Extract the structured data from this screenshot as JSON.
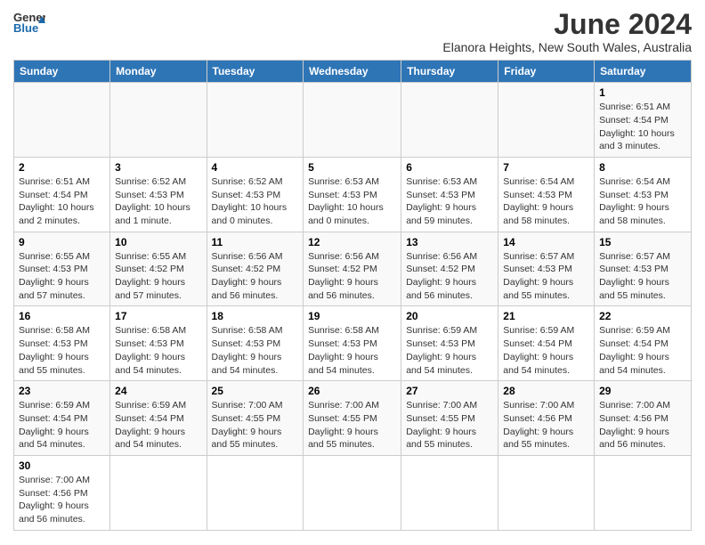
{
  "header": {
    "logo_general": "General",
    "logo_blue": "Blue",
    "title": "June 2024",
    "subtitle": "Elanora Heights, New South Wales, Australia"
  },
  "days_of_week": [
    "Sunday",
    "Monday",
    "Tuesday",
    "Wednesday",
    "Thursday",
    "Friday",
    "Saturday"
  ],
  "weeks": [
    [
      {
        "day": "",
        "info": ""
      },
      {
        "day": "",
        "info": ""
      },
      {
        "day": "",
        "info": ""
      },
      {
        "day": "",
        "info": ""
      },
      {
        "day": "",
        "info": ""
      },
      {
        "day": "",
        "info": ""
      },
      {
        "day": "1",
        "info": "Sunrise: 6:51 AM\nSunset: 4:54 PM\nDaylight: 10 hours and 3 minutes."
      }
    ],
    [
      {
        "day": "2",
        "info": "Sunrise: 6:51 AM\nSunset: 4:54 PM\nDaylight: 10 hours and 2 minutes."
      },
      {
        "day": "3",
        "info": "Sunrise: 6:52 AM\nSunset: 4:53 PM\nDaylight: 10 hours and 1 minute."
      },
      {
        "day": "4",
        "info": "Sunrise: 6:52 AM\nSunset: 4:53 PM\nDaylight: 10 hours and 0 minutes."
      },
      {
        "day": "5",
        "info": "Sunrise: 6:53 AM\nSunset: 4:53 PM\nDaylight: 10 hours and 0 minutes."
      },
      {
        "day": "6",
        "info": "Sunrise: 6:53 AM\nSunset: 4:53 PM\nDaylight: 9 hours and 59 minutes."
      },
      {
        "day": "7",
        "info": "Sunrise: 6:54 AM\nSunset: 4:53 PM\nDaylight: 9 hours and 58 minutes."
      },
      {
        "day": "8",
        "info": "Sunrise: 6:54 AM\nSunset: 4:53 PM\nDaylight: 9 hours and 58 minutes."
      }
    ],
    [
      {
        "day": "9",
        "info": "Sunrise: 6:55 AM\nSunset: 4:53 PM\nDaylight: 9 hours and 57 minutes."
      },
      {
        "day": "10",
        "info": "Sunrise: 6:55 AM\nSunset: 4:52 PM\nDaylight: 9 hours and 57 minutes."
      },
      {
        "day": "11",
        "info": "Sunrise: 6:56 AM\nSunset: 4:52 PM\nDaylight: 9 hours and 56 minutes."
      },
      {
        "day": "12",
        "info": "Sunrise: 6:56 AM\nSunset: 4:52 PM\nDaylight: 9 hours and 56 minutes."
      },
      {
        "day": "13",
        "info": "Sunrise: 6:56 AM\nSunset: 4:52 PM\nDaylight: 9 hours and 56 minutes."
      },
      {
        "day": "14",
        "info": "Sunrise: 6:57 AM\nSunset: 4:53 PM\nDaylight: 9 hours and 55 minutes."
      },
      {
        "day": "15",
        "info": "Sunrise: 6:57 AM\nSunset: 4:53 PM\nDaylight: 9 hours and 55 minutes."
      }
    ],
    [
      {
        "day": "16",
        "info": "Sunrise: 6:58 AM\nSunset: 4:53 PM\nDaylight: 9 hours and 55 minutes."
      },
      {
        "day": "17",
        "info": "Sunrise: 6:58 AM\nSunset: 4:53 PM\nDaylight: 9 hours and 54 minutes."
      },
      {
        "day": "18",
        "info": "Sunrise: 6:58 AM\nSunset: 4:53 PM\nDaylight: 9 hours and 54 minutes."
      },
      {
        "day": "19",
        "info": "Sunrise: 6:58 AM\nSunset: 4:53 PM\nDaylight: 9 hours and 54 minutes."
      },
      {
        "day": "20",
        "info": "Sunrise: 6:59 AM\nSunset: 4:53 PM\nDaylight: 9 hours and 54 minutes."
      },
      {
        "day": "21",
        "info": "Sunrise: 6:59 AM\nSunset: 4:54 PM\nDaylight: 9 hours and 54 minutes."
      },
      {
        "day": "22",
        "info": "Sunrise: 6:59 AM\nSunset: 4:54 PM\nDaylight: 9 hours and 54 minutes."
      }
    ],
    [
      {
        "day": "23",
        "info": "Sunrise: 6:59 AM\nSunset: 4:54 PM\nDaylight: 9 hours and 54 minutes."
      },
      {
        "day": "24",
        "info": "Sunrise: 6:59 AM\nSunset: 4:54 PM\nDaylight: 9 hours and 54 minutes."
      },
      {
        "day": "25",
        "info": "Sunrise: 7:00 AM\nSunset: 4:55 PM\nDaylight: 9 hours and 55 minutes."
      },
      {
        "day": "26",
        "info": "Sunrise: 7:00 AM\nSunset: 4:55 PM\nDaylight: 9 hours and 55 minutes."
      },
      {
        "day": "27",
        "info": "Sunrise: 7:00 AM\nSunset: 4:55 PM\nDaylight: 9 hours and 55 minutes."
      },
      {
        "day": "28",
        "info": "Sunrise: 7:00 AM\nSunset: 4:56 PM\nDaylight: 9 hours and 55 minutes."
      },
      {
        "day": "29",
        "info": "Sunrise: 7:00 AM\nSunset: 4:56 PM\nDaylight: 9 hours and 56 minutes."
      }
    ],
    [
      {
        "day": "30",
        "info": "Sunrise: 7:00 AM\nSunset: 4:56 PM\nDaylight: 9 hours and 56 minutes."
      },
      {
        "day": "",
        "info": ""
      },
      {
        "day": "",
        "info": ""
      },
      {
        "day": "",
        "info": ""
      },
      {
        "day": "",
        "info": ""
      },
      {
        "day": "",
        "info": ""
      },
      {
        "day": "",
        "info": ""
      }
    ]
  ]
}
